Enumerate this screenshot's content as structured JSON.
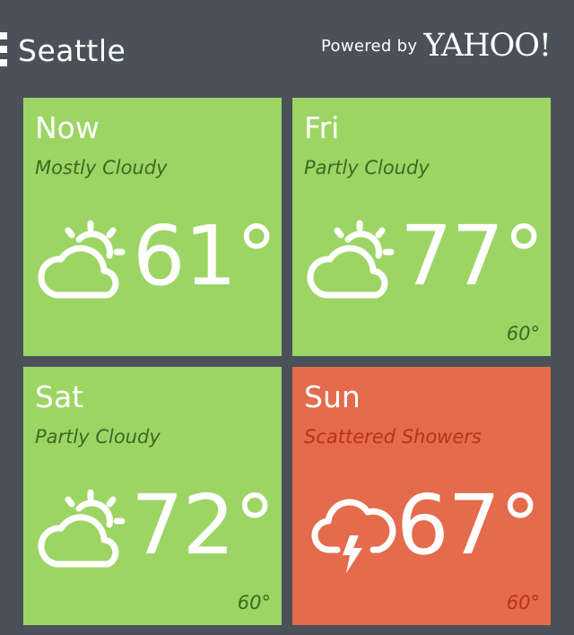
{
  "header": {
    "city": "Seattle",
    "powered_by": "Powered by",
    "brand": "YAHOO!"
  },
  "tiles": [
    {
      "day": "Now",
      "condition": "Mostly Cloudy",
      "temp": "61°",
      "low": "",
      "icon": "partly-cloudy-icon",
      "color": "#9dd565"
    },
    {
      "day": "Fri",
      "condition": "Partly Cloudy",
      "temp": "77°",
      "low": "60°",
      "icon": "partly-cloudy-icon",
      "color": "#9dd565"
    },
    {
      "day": "Sat",
      "condition": "Partly Cloudy",
      "temp": "72°",
      "low": "60°",
      "icon": "partly-cloudy-icon",
      "color": "#9dd565"
    },
    {
      "day": "Sun",
      "condition": "Scattered Showers",
      "temp": "67°",
      "low": "60°",
      "icon": "thunderstorm-icon",
      "color": "#e46b4c"
    }
  ],
  "colors": {
    "background": "#4b5159",
    "tile_good": "#9dd565",
    "tile_bad": "#e46b4c",
    "text": "#ffffff"
  }
}
